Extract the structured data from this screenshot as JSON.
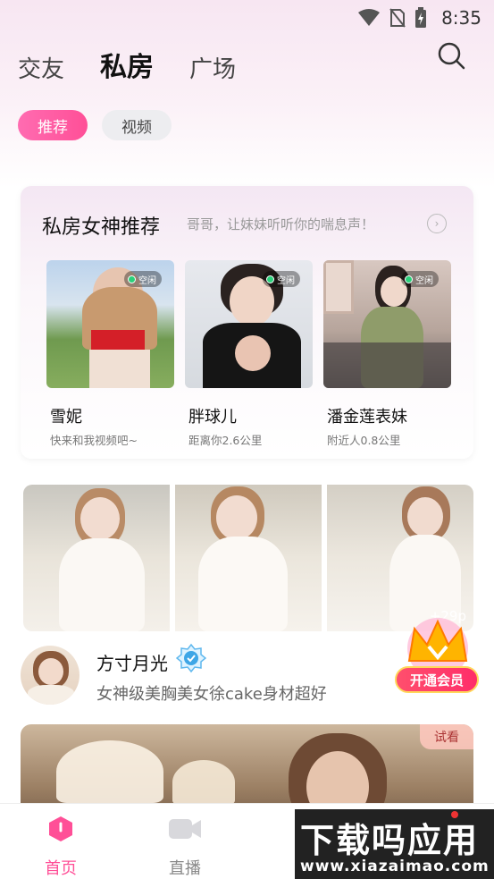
{
  "status_bar": {
    "time": "8:35"
  },
  "top_tabs": [
    {
      "label": "交友",
      "active": false
    },
    {
      "label": "私房",
      "active": true
    },
    {
      "label": "广场",
      "active": false
    }
  ],
  "pills": [
    {
      "label": "推荐",
      "active": true
    },
    {
      "label": "视频",
      "active": false
    }
  ],
  "goddess": {
    "title": "私房女神推荐",
    "subtitle": "哥哥，让妹妹听听你的喘息声！",
    "profiles": [
      {
        "status": "空闲",
        "name": "雪妮",
        "desc": "快来和我视频吧~"
      },
      {
        "status": "空闲",
        "name": "胖球儿",
        "desc": "距离你2.6公里"
      },
      {
        "status": "空闲",
        "name": "潘金莲表妹",
        "desc": "附近人0.8公里"
      }
    ]
  },
  "post": {
    "more_count": "+29p",
    "author": "方寸月光",
    "text": "女神级美胸美女徐cake身材超好"
  },
  "vip": {
    "label": "开通会员"
  },
  "video_card": {
    "tag": "试看"
  },
  "bottom_nav": [
    {
      "label": "首页",
      "active": true
    },
    {
      "label": "直播",
      "active": false
    }
  ],
  "watermark": {
    "line1": "下载吗应用",
    "line2": "www.xiazaimao.com"
  },
  "colors": {
    "accent": "#ff4f97",
    "online": "#2ad17a"
  }
}
